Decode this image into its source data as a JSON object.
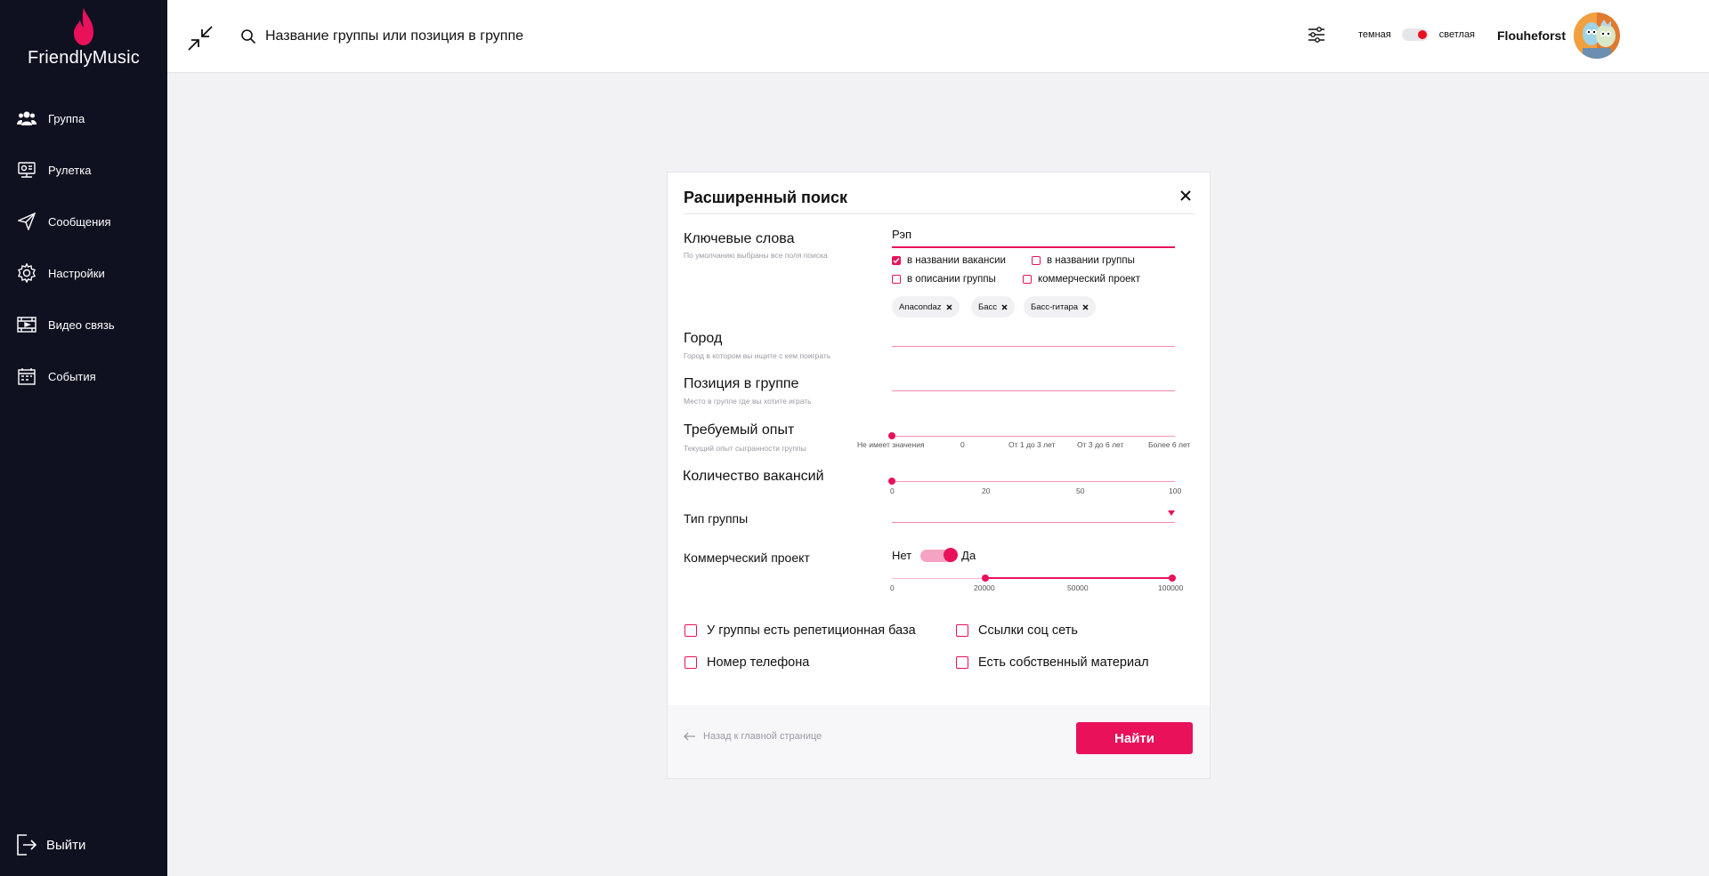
{
  "app": {
    "name": "FriendlyMusic"
  },
  "sidebar": {
    "items": [
      {
        "label": "Группа",
        "icon": "users-icon"
      },
      {
        "label": "Рулетка",
        "icon": "roulette-icon"
      },
      {
        "label": "Сообщения",
        "icon": "send-icon"
      },
      {
        "label": "Настройки",
        "icon": "gear-icon"
      },
      {
        "label": "Видео связь",
        "icon": "video-icon"
      },
      {
        "label": "События",
        "icon": "calendar-icon"
      }
    ],
    "logout_label": "Выйти"
  },
  "header": {
    "search_placeholder": "Название группы или позиция в группе",
    "theme_dark_label": "темная",
    "theme_light_label": "светлая",
    "theme_value": "светлая",
    "username": "Flouheforst"
  },
  "modal": {
    "title": "Расширенный поиск",
    "keywords": {
      "label": "Ключевые слова",
      "hint": "По умолчанию выбраны все поля поиска",
      "value": "Рэп",
      "options": [
        {
          "label": "в названии вакансии",
          "checked": true
        },
        {
          "label": "в названии группы",
          "checked": false
        },
        {
          "label": "в описании группы",
          "checked": false
        },
        {
          "label": "коммерческий проект",
          "checked": false
        }
      ],
      "chips": [
        "Anacondaz",
        "Басс",
        "Басс-гитара"
      ]
    },
    "city": {
      "label": "Город",
      "hint": "Город в котором вы ищите с кем поиграть",
      "value": ""
    },
    "position": {
      "label": "Позиция в группе",
      "hint": "Место в группе где вы хотите играть",
      "value": ""
    },
    "experience": {
      "label": "Требуемый опыт",
      "hint": "Текущий опыт сыгранности группы",
      "ticks": [
        "Не имеет значения",
        "0",
        "От 1 до 3 лет",
        "От 3 до 6 лет",
        "Более 6 лет"
      ],
      "value": "Не имеет значения"
    },
    "vacancies": {
      "label": "Количество вакансий",
      "ticks": [
        "0",
        "20",
        "50",
        "100"
      ],
      "value": 0
    },
    "group_type": {
      "label": "Тип группы",
      "value": ""
    },
    "commercial": {
      "label": "Коммерческий проект",
      "no_label": "Нет",
      "yes_label": "Да",
      "toggle_value": "Да",
      "range_ticks": [
        "0",
        "20000",
        "50000",
        "100000"
      ],
      "range_min": 20000,
      "range_max": 100000
    },
    "extra_checkboxes": [
      {
        "label": "У группы есть репетиционная база",
        "checked": false
      },
      {
        "label": "Ссылки соц сеть",
        "checked": false
      },
      {
        "label": "Номер телефона",
        "checked": false
      },
      {
        "label": "Есть собственный материал",
        "checked": false
      }
    ],
    "footer": {
      "back_label": "Назад к главной странице",
      "find_label": "Найти"
    }
  },
  "colors": {
    "accent": "#e8115a",
    "sidebar_bg": "#0f1120",
    "page_bg": "#f2f1f4"
  }
}
